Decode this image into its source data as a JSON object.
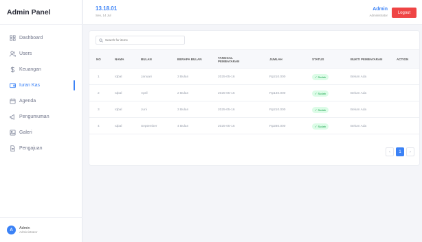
{
  "brand": "Admin Panel",
  "sidebar": {
    "items": [
      {
        "label": "Dashboard",
        "icon": "grid-icon"
      },
      {
        "label": "Users",
        "icon": "users-icon"
      },
      {
        "label": "Keuangan",
        "icon": "dollar-icon"
      },
      {
        "label": "Iuran Kas",
        "icon": "wallet-icon",
        "active": true
      },
      {
        "label": "Agenda",
        "icon": "calendar-icon"
      },
      {
        "label": "Pengumuman",
        "icon": "megaphone-icon"
      },
      {
        "label": "Galeri",
        "icon": "image-icon"
      },
      {
        "label": "Pengajuan",
        "icon": "document-icon"
      }
    ],
    "user": {
      "initial": "A",
      "name": "Admin",
      "role": "Administrator"
    }
  },
  "topbar": {
    "time": "13.18.01",
    "date": "Sen, 14 Jul",
    "admin_name": "Admin",
    "admin_role": "Administrator",
    "logout_label": "Logout"
  },
  "search": {
    "placeholder": "Search for items"
  },
  "table": {
    "headers": [
      "NO",
      "NAMA",
      "BULAN",
      "BERAPA BULAN",
      "TANGGAL PEMBAYARAN",
      "JUMLAH",
      "STATUS",
      "BUKTI PEMBAYARAN",
      "ACTION"
    ],
    "rows": [
      {
        "no": "1",
        "nama": "Iqbal",
        "bulan": "Januari",
        "berapa": "3 Bulan",
        "tanggal": "2025-05-16",
        "jumlah": "Rp210.000",
        "status": "✓ Sudah",
        "bukti": "Belum Ada"
      },
      {
        "no": "2",
        "nama": "Iqbal",
        "bulan": "April",
        "berapa": "2 Bulan",
        "tanggal": "2025-05-16",
        "jumlah": "Rp140.000",
        "status": "✓ Sudah",
        "bukti": "Belum Ada"
      },
      {
        "no": "3",
        "nama": "Iqbal",
        "bulan": "Juni",
        "berapa": "3 Bulan",
        "tanggal": "2025-05-16",
        "jumlah": "Rp210.000",
        "status": "✓ Sudah",
        "bukti": "Belum Ada"
      },
      {
        "no": "4",
        "nama": "Iqbal",
        "bulan": "September",
        "berapa": "4 Bulan",
        "tanggal": "2025-05-16",
        "jumlah": "Rp280.000",
        "status": "✓ Sudah",
        "bukti": "Belum Ada"
      }
    ]
  },
  "pagination": {
    "prev": "‹",
    "current": "1",
    "next": "›"
  },
  "colors": {
    "accent": "#3b82f6",
    "logout": "#ef4444",
    "success_bg": "#dcfce7",
    "success_text": "#16a34a"
  }
}
